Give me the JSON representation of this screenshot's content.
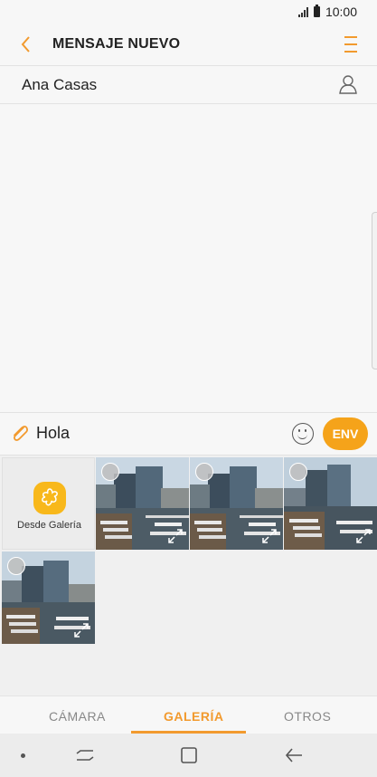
{
  "status_bar": {
    "time": "10:00"
  },
  "header": {
    "title": "MENSAJE NUEVO"
  },
  "recipient": {
    "name": "Ana Casas"
  },
  "composer": {
    "message": "Hola",
    "send_label": "ENV"
  },
  "gallery": {
    "from_gallery_label": "Desde Galería",
    "photo_count": 4
  },
  "tabs": [
    {
      "label": "CÁMARA",
      "active": false
    },
    {
      "label": "GALERÍA",
      "active": true
    },
    {
      "label": "OTROS",
      "active": false
    }
  ],
  "colors": {
    "accent": "#f29a2e",
    "send_button": "#f5a31a",
    "gallery_app_icon": "#f8b81b"
  },
  "icons": {
    "back": "chevron-left-icon",
    "menu": "hamburger-menu-icon",
    "contact": "person-icon",
    "attach": "paperclip-icon",
    "emoji": "smiley-icon",
    "select": "select-circle-icon",
    "expand": "expand-icon",
    "nav_recent": "recent-apps-icon",
    "nav_home": "home-icon",
    "nav_back": "back-arrow-icon"
  }
}
